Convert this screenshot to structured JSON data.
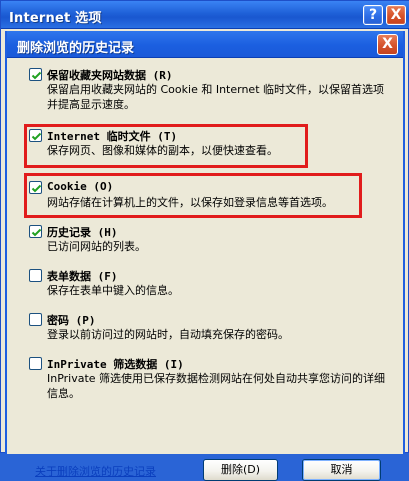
{
  "outer_window": {
    "title": "Internet 选项",
    "help_button": "?",
    "close_button": "X"
  },
  "dialog": {
    "title": "删除浏览的历史记录",
    "close_button": "X",
    "options": [
      {
        "label": "保留收藏夹网站数据 (R)",
        "description": "保留启用收藏夹网站的 Cookie 和 Internet 临时文件，以保留首选项并提高显示速度。",
        "checked": true
      },
      {
        "label": "Internet 临时文件 (T)",
        "description": "保存网页、图像和媒体的副本，以便快速查看。",
        "checked": true
      },
      {
        "label": "Cookie (O)",
        "description": "网站存储在计算机上的文件，以保存如登录信息等首选项。",
        "checked": true
      },
      {
        "label": "历史记录 (H)",
        "description": "已访问网站的列表。",
        "checked": true
      },
      {
        "label": "表单数据 (F)",
        "description": "保存在表单中键入的信息。",
        "checked": false
      },
      {
        "label": "密码 (P)",
        "description": "登录以前访问过的网站时，自动填充保存的密码。",
        "checked": false
      },
      {
        "label": "InPrivate 筛选数据 (I)",
        "description": "InPrivate 筛选使用已保存数据检测网站在何处自动共享您访问的详细信息。",
        "checked": false
      }
    ],
    "footer": {
      "link_text": "关于删除浏览的历史记录",
      "delete_button": "删除(D)",
      "cancel_button": "取消"
    }
  },
  "colors": {
    "highlight": "#e11c1c",
    "link": "#0b3fbe",
    "titlebar": "#1f61d8"
  }
}
